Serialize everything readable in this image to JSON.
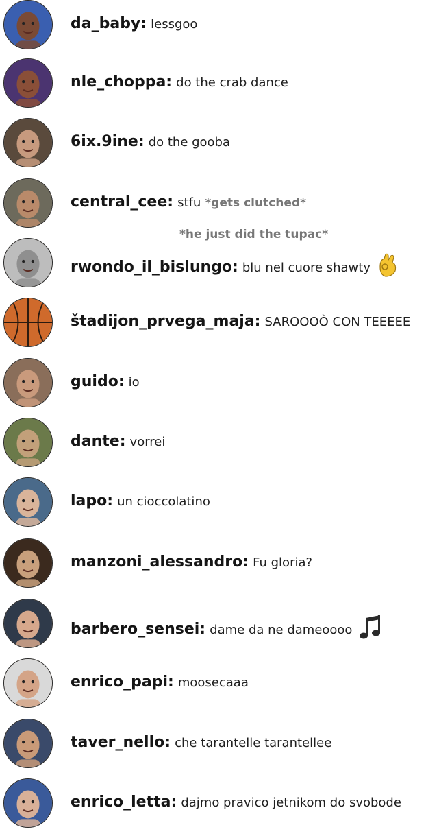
{
  "messages": [
    {
      "user": "da_baby:",
      "text": "lessgoo",
      "avatar_color": "#3a5fb0",
      "avatar_skin": "#7a4a35"
    },
    {
      "user": "nle_choppa:",
      "text": "do the crab dance",
      "avatar_color": "#4b3470",
      "avatar_skin": "#8a4f38"
    },
    {
      "user": "6ix.9ine:",
      "text": "do the gooba",
      "avatar_color": "#5a4a3c",
      "avatar_skin": "#c79a7e"
    },
    {
      "user": "central_cee:",
      "text": "stfu",
      "action": "*gets clutched*",
      "avatar_color": "#6d6a5c",
      "avatar_skin": "#b98a6a"
    },
    {
      "user": "rwondo_il_bislungo:",
      "text": "blu nel cuore shawty",
      "emoji": "ok-hand-emoji",
      "avatar_color": "#bdbdbd",
      "avatar_skin": "#8f8f8f"
    },
    {
      "user": "štadijon_prvega_maja:",
      "text": "SAROOOÒ CON TEEEEE",
      "avatar_color": "#c8602a",
      "avatar_skin": "#d0703a"
    },
    {
      "user": "guido:",
      "text": "io",
      "avatar_color": "#8a6e5a",
      "avatar_skin": "#c99a7c"
    },
    {
      "user": "dante:",
      "text": "vorrei",
      "avatar_color": "#6b7a4a",
      "avatar_skin": "#c2a07a"
    },
    {
      "user": "lapo:",
      "text": "un cioccolatino",
      "avatar_color": "#4a6a8a",
      "avatar_skin": "#d9b49a"
    },
    {
      "user": "manzoni_alessandro:",
      "text": "Fu gloria?",
      "avatar_color": "#3b2a1e",
      "avatar_skin": "#c8a07c"
    },
    {
      "user": "barbero_sensei:",
      "text": "dame da ne dameoooo",
      "emoji": "music-note-emoji",
      "avatar_color": "#2f3a4a",
      "avatar_skin": "#d6a88c"
    },
    {
      "user": "enrico_papi:",
      "text": "moosecaaa",
      "avatar_color": "#d9d9d9",
      "avatar_skin": "#d4a487"
    },
    {
      "user": "taver_nello:",
      "text": "che tarantelle tarantellee",
      "avatar_color": "#3a4a6a",
      "avatar_skin": "#c99a78"
    },
    {
      "user": "enrico_letta:",
      "text": "dajmo pravico jetnikom do svobode",
      "avatar_color": "#3a5a9a",
      "avatar_skin": "#d8b098"
    }
  ],
  "subaction": "*he just did the tupac*"
}
